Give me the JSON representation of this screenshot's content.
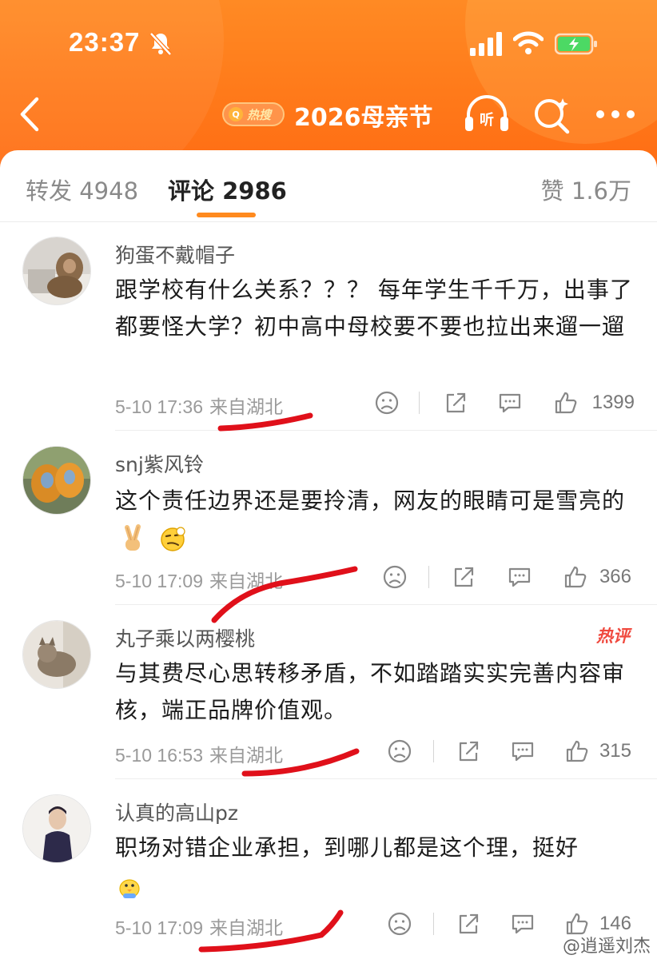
{
  "status_bar": {
    "time": "23:37"
  },
  "nav": {
    "hot_badge": "热搜",
    "topic": "2026母亲节"
  },
  "tabs": {
    "repost": "转发 4948",
    "comment": "评论 2986",
    "like": "赞 1.6万"
  },
  "comments": [
    {
      "name": "狗蛋不戴帽子",
      "text": "跟学校有什么关系？？？ 每年学生千千万，出事了都要怪大学？初中高中母校要不要也拉出来遛一遛",
      "time": "5-10 17:36",
      "location": "来自湖北",
      "likes": "1399"
    },
    {
      "name": "snj紫风铃",
      "text": "这个责任边界还是要拎清，网友的眼睛可是雪亮的",
      "time": "5-10 17:09",
      "location": "来自湖北",
      "likes": "366"
    },
    {
      "name": "丸子乘以两樱桃",
      "text": "与其费尽心思转移矛盾，不如踏踏实实完善内容审核，端正品牌价值观。",
      "time": "5-10 16:53",
      "location": "来自湖北",
      "likes": "315",
      "badge": "热评"
    },
    {
      "name": "认真的高山pz",
      "text": "职场对错企业承担，到哪儿都是这个理，挺好",
      "time": "5-10 17:09",
      "location": "来自湖北",
      "likes": "146"
    }
  ],
  "watermark": "@逍遥刘杰",
  "colors": {
    "accent": "#ff7a1a",
    "underline": "#ff8a1e",
    "annotation": "#e0101a",
    "hot": "#f0493e"
  }
}
